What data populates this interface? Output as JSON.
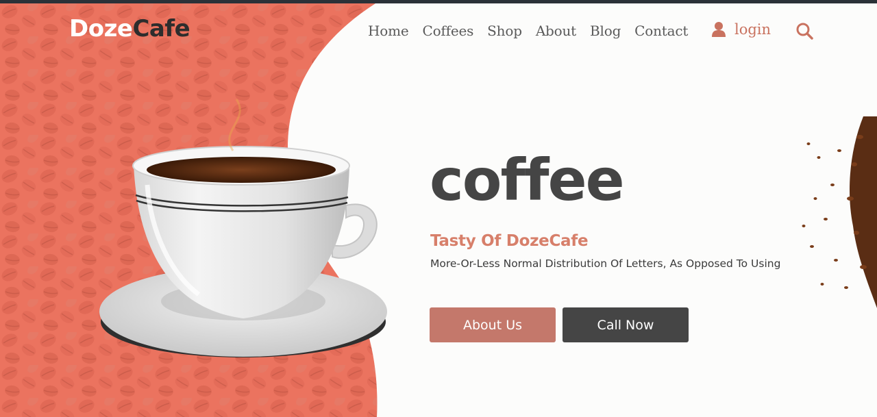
{
  "brand": {
    "part1": "Doze",
    "part2": "Cafe"
  },
  "nav": {
    "items": [
      {
        "label": "Home"
      },
      {
        "label": "Coffees"
      },
      {
        "label": "Shop"
      },
      {
        "label": "About"
      },
      {
        "label": "Blog"
      },
      {
        "label": "Contact"
      }
    ]
  },
  "header": {
    "login_label": "login",
    "user_icon": "user-icon",
    "search_icon": "search-icon"
  },
  "hero": {
    "title": "coffee",
    "subtitle": "Tasty Of DozeCafe",
    "description": "More-Or-Less Normal Distribution Of Letters, As Opposed To Using",
    "about_button": "About Us",
    "call_button": "Call Now"
  },
  "colors": {
    "accent": "#c4786b",
    "subtitle": "#d77f6a",
    "dark_button": "#454545",
    "bean_background": "#e8715f",
    "topbar": "#2b3138"
  }
}
